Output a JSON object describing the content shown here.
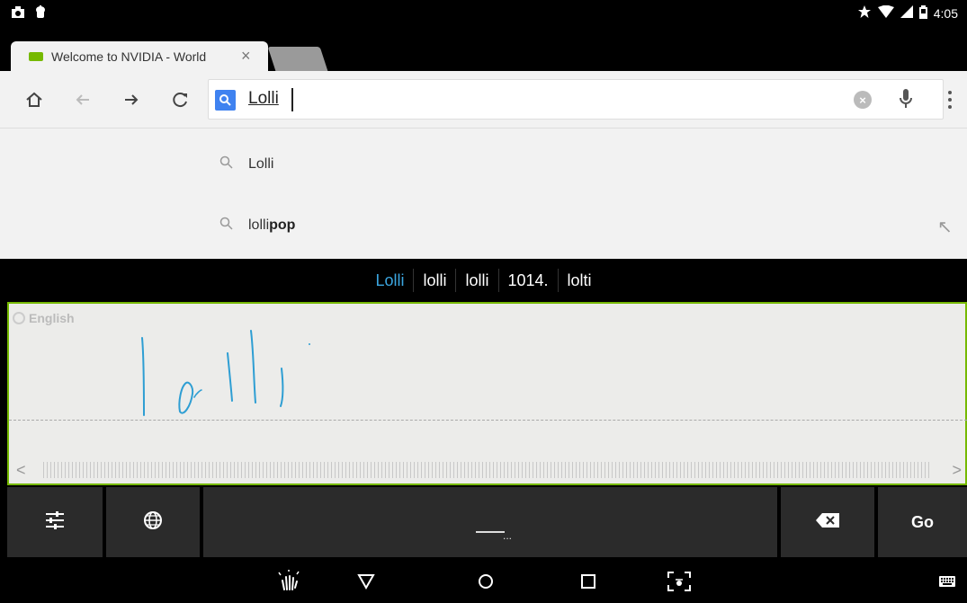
{
  "status_bar": {
    "time": "4:05",
    "left_icons": [
      "screenshot-icon",
      "android-debug-icon"
    ],
    "right_icons": [
      "star-icon",
      "wifi-icon",
      "signal-icon",
      "battery-icon"
    ]
  },
  "tabs": [
    {
      "title": "Welcome to NVIDIA - World",
      "close_label": "×"
    }
  ],
  "toolbar": {
    "home_icon": "home-icon",
    "back_icon": "back-arrow-icon",
    "forward_icon": "forward-arrow-icon",
    "reload_icon": "reload-icon",
    "omnibox_value": "Lolli",
    "clear_label": "×",
    "mic_icon": "mic-icon",
    "menu_icon": "overflow-menu-icon"
  },
  "suggestions": [
    {
      "prefix": "Lolli",
      "suffix": ""
    },
    {
      "prefix": "lolli",
      "suffix": "pop"
    }
  ],
  "suggestion_arrow": "↖",
  "candidates": [
    "Lolli",
    "lolli",
    "lolli",
    "1014.",
    "lolti"
  ],
  "handwriting": {
    "language": "English",
    "scroll_left": "<",
    "scroll_right": ">"
  },
  "keyboard": {
    "settings_icon": "sliders-icon",
    "language_icon": "globe-icon",
    "space_dots": "...",
    "backspace_icon": "backspace-icon",
    "go_label": "Go"
  },
  "nav": {
    "icons": [
      "gesture-icon",
      "back-triangle-icon",
      "home-circle-icon",
      "recents-square-icon",
      "screenshot-frame-icon",
      "keyboard-icon"
    ]
  },
  "colors": {
    "accent_green": "#76b900",
    "candidate_highlight": "#3ba6e0",
    "ink_blue": "#2e9ed3",
    "search_blue": "#3f82f0"
  }
}
